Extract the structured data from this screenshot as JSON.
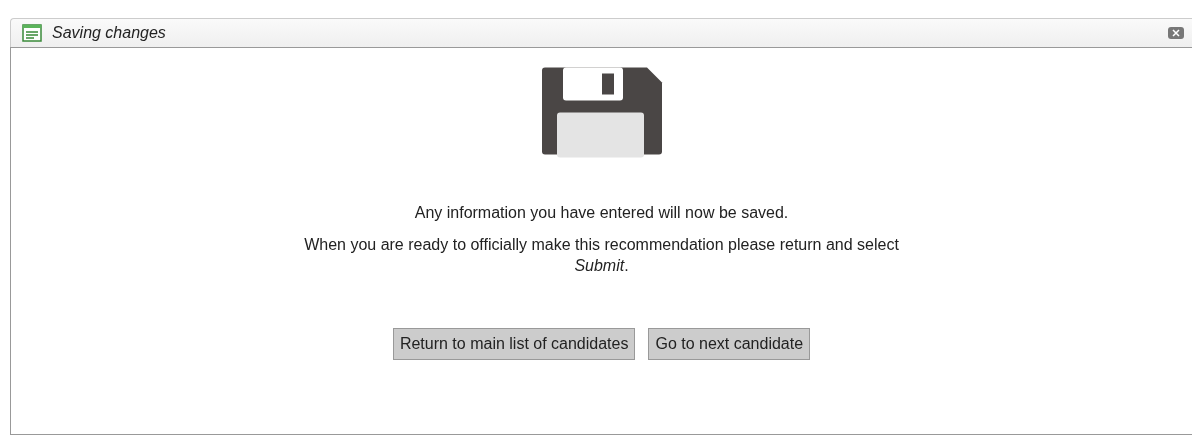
{
  "dialog": {
    "title": "Saving changes",
    "messages": [
      "Any information you have entered will now be saved.",
      "When you are ready to officially make this recommendation please return and select *Submit*."
    ],
    "buttons": [
      "Return to main list of candidates",
      "Go to next candidate"
    ]
  }
}
